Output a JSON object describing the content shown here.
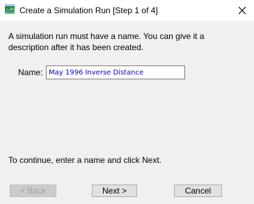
{
  "window": {
    "title": "Create a Simulation Run [Step 1 of 4]"
  },
  "content": {
    "description": "A simulation run must have a name. You can give it a description after it has been created.",
    "name_label": "Name:",
    "name_value": "May 1996 Inverse Distance",
    "hint": "To continue, enter a name and click Next."
  },
  "buttons": {
    "back": "< Back",
    "next": "Next >",
    "cancel": "Cancel"
  },
  "icons": {
    "app": "hec-hms-app-icon",
    "close": "close-icon"
  },
  "colors": {
    "input_text": "#0000cc",
    "disabled_text": "#a0a0a0"
  }
}
